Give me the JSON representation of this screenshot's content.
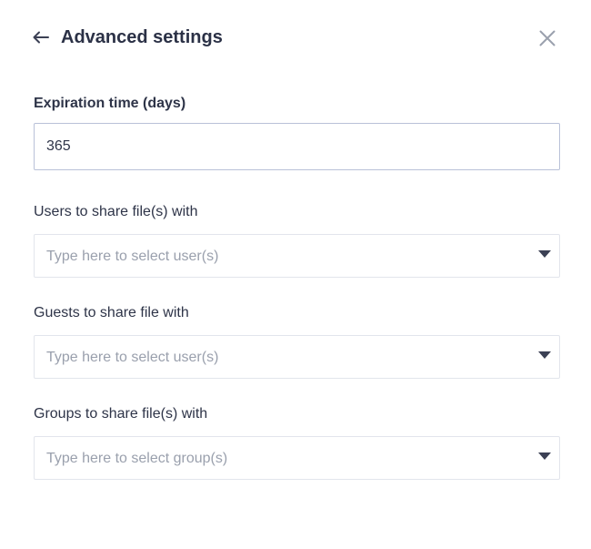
{
  "header": {
    "title": "Advanced settings",
    "back_icon": "arrow-left-icon",
    "close_icon": "close-icon"
  },
  "expiration": {
    "label": "Expiration time (days)",
    "value": "365"
  },
  "users": {
    "label": "Users to share file(s) with",
    "placeholder": "Type here to select user(s)"
  },
  "guests": {
    "label": "Guests to share file with",
    "placeholder": "Type here to select user(s)"
  },
  "groups": {
    "label": "Groups to share file(s) with",
    "placeholder": "Type here to select group(s)"
  },
  "colors": {
    "text": "#2e3448",
    "placeholder": "#9aa0ad",
    "input_border_active": "#b9c1d8",
    "input_border": "#e2e5ec",
    "icon": "#3b4054",
    "close": "#9aa0ad"
  }
}
